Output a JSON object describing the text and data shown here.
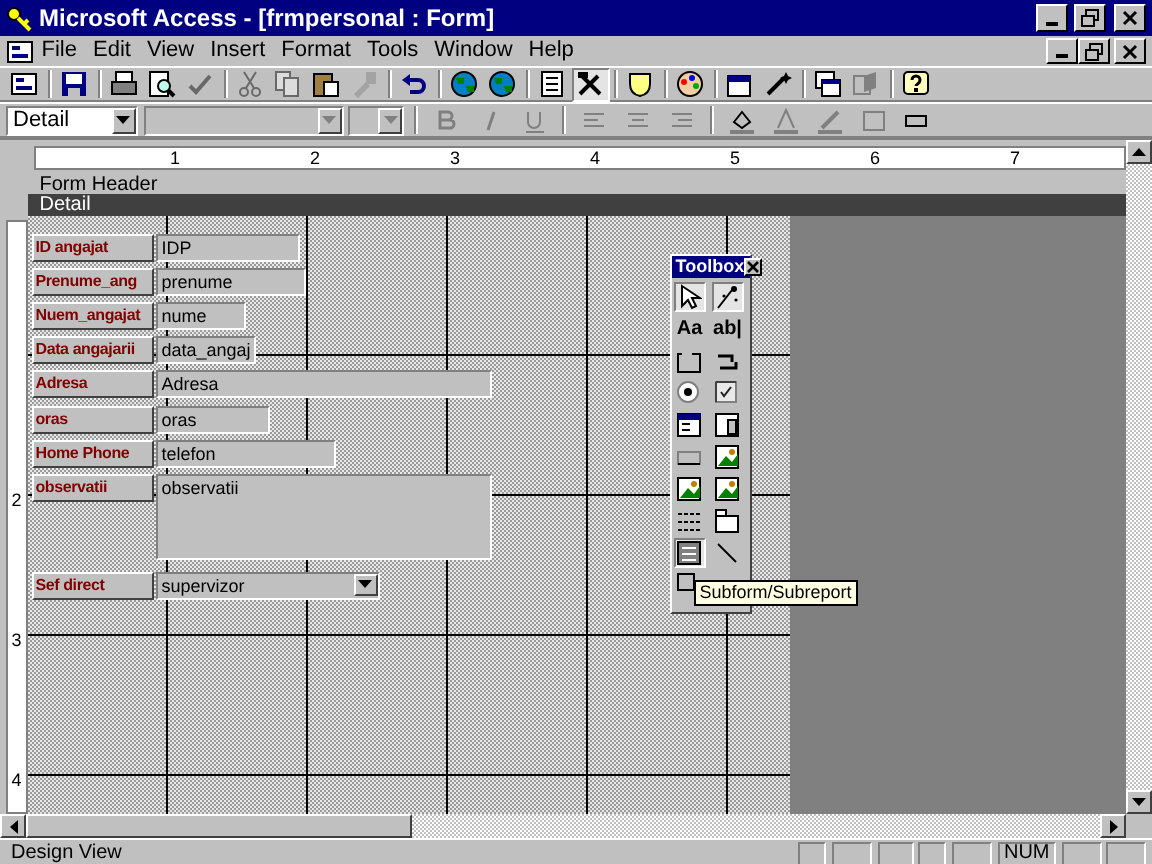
{
  "window": {
    "title": "Microsoft Access - [frmpersonal : Form]"
  },
  "menu": [
    "File",
    "Edit",
    "View",
    "Insert",
    "Format",
    "Tools",
    "Window",
    "Help"
  ],
  "toolbar": [
    {
      "kind": "view",
      "disabled": false,
      "pressed": false
    },
    {
      "kind": "sep"
    },
    {
      "kind": "save",
      "disabled": false,
      "pressed": false
    },
    {
      "kind": "sep"
    },
    {
      "kind": "print",
      "disabled": false,
      "pressed": false
    },
    {
      "kind": "preview",
      "disabled": false,
      "pressed": false
    },
    {
      "kind": "spell",
      "disabled": true,
      "pressed": false
    },
    {
      "kind": "sep"
    },
    {
      "kind": "cut",
      "disabled": true,
      "pressed": false
    },
    {
      "kind": "copy",
      "disabled": true,
      "pressed": false
    },
    {
      "kind": "paste",
      "disabled": false,
      "pressed": false
    },
    {
      "kind": "brush",
      "disabled": true,
      "pressed": false
    },
    {
      "kind": "sep"
    },
    {
      "kind": "undo",
      "disabled": false,
      "pressed": false
    },
    {
      "kind": "sep"
    },
    {
      "kind": "globe",
      "disabled": false,
      "pressed": false
    },
    {
      "kind": "globe",
      "disabled": false,
      "pressed": false
    },
    {
      "kind": "sep"
    },
    {
      "kind": "list",
      "disabled": false,
      "pressed": false
    },
    {
      "kind": "tools",
      "disabled": false,
      "pressed": true
    },
    {
      "kind": "sep"
    },
    {
      "kind": "shield",
      "disabled": false,
      "pressed": false
    },
    {
      "kind": "sep"
    },
    {
      "kind": "palette",
      "disabled": false,
      "pressed": false
    },
    {
      "kind": "sep"
    },
    {
      "kind": "props",
      "disabled": false,
      "pressed": false
    },
    {
      "kind": "wand",
      "disabled": false,
      "pressed": false
    },
    {
      "kind": "sep"
    },
    {
      "kind": "windows",
      "disabled": false,
      "pressed": false
    },
    {
      "kind": "newobj",
      "disabled": false,
      "pressed": false
    },
    {
      "kind": "sep"
    },
    {
      "kind": "help",
      "disabled": false,
      "pressed": false
    }
  ],
  "format_toolbar": {
    "object": "Detail"
  },
  "ruler": [
    "1",
    "2",
    "3",
    "4",
    "5",
    "6",
    "7"
  ],
  "vertical_ruler": [
    "2",
    "3",
    "4"
  ],
  "sections": [
    {
      "label": "Form Header",
      "selected": false
    },
    {
      "label": "Detail",
      "selected": true
    }
  ],
  "controls": [
    {
      "label": "ID angajat",
      "value": "IDP",
      "kind": "text"
    },
    {
      "label": "Prenume_ang",
      "value": "prenume",
      "kind": "text"
    },
    {
      "label": "Nuem_angajat",
      "value": "nume",
      "kind": "text"
    },
    {
      "label": "Data angajarii",
      "value": "data_angaj",
      "kind": "text"
    },
    {
      "label": "Adresa",
      "value": "Adresa",
      "kind": "text"
    },
    {
      "label": "oras",
      "value": "oras",
      "kind": "text"
    },
    {
      "label": "Home Phone",
      "value": "telefon",
      "kind": "text"
    },
    {
      "label": "observatii",
      "value": "observatii",
      "kind": "memo"
    },
    {
      "label": "Sef direct",
      "value": "supervizor",
      "kind": "combo"
    }
  ],
  "toolbox": {
    "title": "Toolbox",
    "tools": [
      {
        "kind": "pointer",
        "selected": true
      },
      {
        "kind": "wizard",
        "selected": true
      },
      {
        "kind": "glyph",
        "text": "Aa",
        "selected": false
      },
      {
        "kind": "glyph",
        "text": "ab|",
        "selected": false
      },
      {
        "kind": "group",
        "selected": false
      },
      {
        "kind": "toggle",
        "selected": false
      },
      {
        "kind": "radio",
        "selected": false
      },
      {
        "kind": "check",
        "selected": false
      },
      {
        "kind": "combo",
        "selected": false
      },
      {
        "kind": "listbox",
        "selected": false
      },
      {
        "kind": "button",
        "selected": false
      },
      {
        "kind": "image",
        "selected": false
      },
      {
        "kind": "image",
        "selected": false
      },
      {
        "kind": "image",
        "selected": false
      },
      {
        "kind": "pagebreak",
        "selected": false
      },
      {
        "kind": "tab",
        "selected": false
      },
      {
        "kind": "subform",
        "selected": true
      },
      {
        "kind": "line",
        "selected": false
      },
      {
        "kind": "rect",
        "selected": false
      }
    ],
    "tooltip": "Subform/Subreport"
  },
  "status_bar": {
    "text": "Design View",
    "num": "NUM"
  }
}
